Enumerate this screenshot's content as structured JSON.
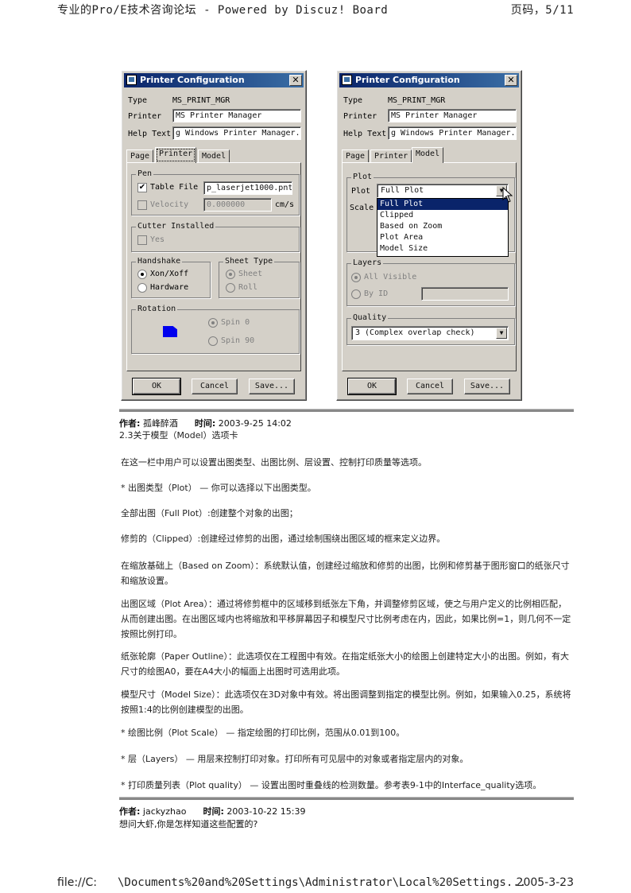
{
  "header": {
    "left": "专业的Pro/E技术咨询论坛 - Powered by Discuz! Board",
    "right": "页码，5/11"
  },
  "footer": {
    "left": "file://C:",
    "path": "\\Documents%20and%20Settings\\Administrator\\Local%20Settings...",
    "date": "2005-3-23"
  },
  "dialog": {
    "title": "Printer Configuration",
    "close": "✕",
    "type_label": "Type",
    "type_value": "MS_PRINT_MGR",
    "printer_label": "Printer",
    "printer_value": "MS Printer Manager",
    "help_label": "Help Text",
    "help_value": "g Windows Printer Manager.",
    "tabs": [
      "Page",
      "Printer",
      "Model"
    ],
    "buttons": {
      "ok": "OK",
      "cancel": "Cancel",
      "save": "Save..."
    }
  },
  "printer_tab": {
    "pen_group": "Pen",
    "table_file_label": "Table File",
    "table_file_value": "p_laserjet1000.pnt",
    "velocity_label": "Velocity",
    "velocity_value": "0.000000",
    "velocity_unit": "cm/s",
    "cutter_group": "Cutter Installed",
    "cutter_yes": "Yes",
    "handshake_group": "Handshake",
    "xon": "Xon/Xoff",
    "hardware": "Hardware",
    "sheet_group": "Sheet Type",
    "sheet": "Sheet",
    "roll": "Roll",
    "rotation_group": "Rotation",
    "spin0": "Spin 0",
    "spin90": "Spin 90"
  },
  "model_tab": {
    "plot_group": "Plot",
    "plot_label": "Plot",
    "plot_value": "Full Plot",
    "scale_label": "Scale",
    "plot_options": [
      "Full Plot",
      "Clipped",
      "Based on Zoom",
      "Plot Area",
      "Model Size"
    ],
    "layers_group": "Layers",
    "all_visible": "All Visible",
    "by_id": "By ID",
    "quality_group": "Quality",
    "quality_value": "3 (Complex overlap check)"
  },
  "post1": {
    "author_label": "作者:",
    "author": "孤峰醉酒",
    "time_label": "时间:",
    "time": "2003-9-25 14:02"
  },
  "post1_body": [
    "2.3关于模型（Model）选项卡",
    "在这一栏中用户可以设置出图类型、出图比例、层设置、控制打印质量等选项。",
    "* 出图类型（Plot） — 你可以选择以下出图类型。",
    "全部出图（Full Plot）:创建整个对象的出图；",
    "修剪的（Clipped）:创建经过修剪的出图，通过绘制围绕出图区域的框来定义边界。",
    "在缩放基础上（Based on Zoom）：系统默认值，创建经过缩放和修剪的出图，比例和修剪基于图形窗口的纸张尺寸和缩放设置。",
    "出图区域（Plot Area）：通过将修剪框中的区域移到纸张左下角，并调整修剪区域，使之与用户定义的比例相匹配，从而创建出图。在出图区域内也将缩放和平移屏幕因子和模型尺寸比例考虑在内，因此，如果比例=1，则几何不一定按照比例打印。",
    "纸张轮廓（Paper Outline）：此选项仅在工程图中有效。在指定纸张大小的绘图上创建特定大小的出图。例如，有大尺寸的绘图A0，要在A4大小的幅面上出图时可选用此项。",
    "模型尺寸（Model Size）：此选项仅在3D对象中有效。将出图调整到指定的模型比例。例如，如果输入0.25，系统将按照1:4的比例创建模型的出图。",
    "* 绘图比例（Plot Scale） — 指定绘图的打印比例，范围从0.01到100。",
    "* 层（Layers） — 用层来控制打印对象。打印所有可见层中的对象或者指定层内的对象。",
    "* 打印质量列表（Plot quality） — 设置出图时重叠线的检测数量。参考表9-1中的Interface_quality选项。"
  ],
  "post2": {
    "author_label": "作者:",
    "author": "jackyzhao",
    "time_label": "时间:",
    "time": "2003-10-22 15:39",
    "body": "想问大虾,你是怎样知道这些配置的?"
  },
  "colors": {
    "dialog_bg": "#d4d0c8",
    "titlebar": "#0a246a",
    "selection": "#0a246a",
    "swatch": "#0000ee"
  }
}
